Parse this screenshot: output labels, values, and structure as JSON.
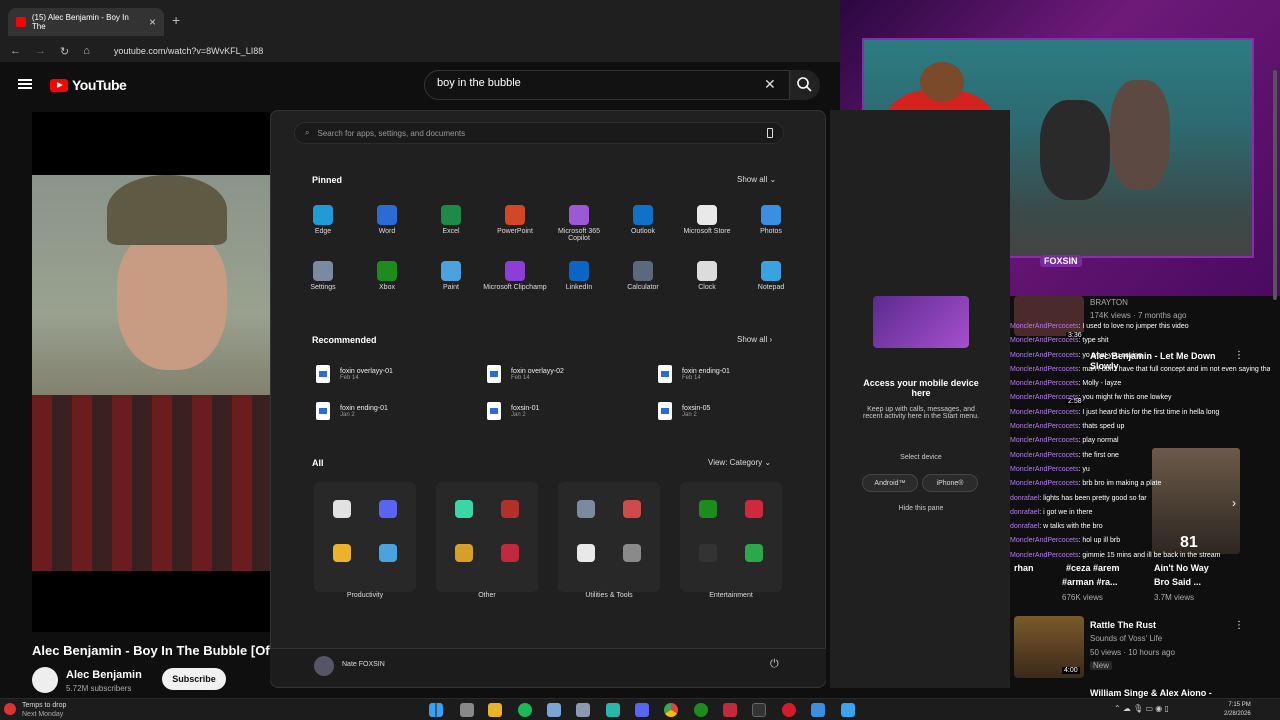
{
  "browser": {
    "tab_title": "(15) Alec Benjamin - Boy In The",
    "url": "youtube.com/watch?v=8WvKFL_LI88"
  },
  "youtube": {
    "logo_text": "YouTube",
    "search_query": "boy in the bubble"
  },
  "video": {
    "title": "Alec Benjamin - Boy In The Bubble [Offi",
    "channel": "Alec Benjamin",
    "subscribers": "5.72M subscribers",
    "subscribe_label": "Subscribe"
  },
  "start_menu": {
    "search_placeholder": "Search for apps, settings, and documents",
    "pinned_label": "Pinned",
    "show_all_label": "Show all",
    "pinned": [
      {
        "label": "Edge",
        "color": "#1f9bd7"
      },
      {
        "label": "Word",
        "color": "#2b6cd4"
      },
      {
        "label": "Excel",
        "color": "#1e8a4a"
      },
      {
        "label": "PowerPoint",
        "color": "#d24726"
      },
      {
        "label": "Microsoft 365 Copilot",
        "color": "#9b59d6"
      },
      {
        "label": "Outlook",
        "color": "#1072c7"
      },
      {
        "label": "Microsoft Store",
        "color": "#e9e9e9"
      },
      {
        "label": "Photos",
        "color": "#3a8fe0"
      },
      {
        "label": "Settings",
        "color": "#7a8aa0"
      },
      {
        "label": "Xbox",
        "color": "#1c8c1c"
      },
      {
        "label": "Paint",
        "color": "#4aa3df"
      },
      {
        "label": "Microsoft Clipchamp",
        "color": "#8c3fd6"
      },
      {
        "label": "LinkedIn",
        "color": "#0a66c2"
      },
      {
        "label": "Calculator",
        "color": "#5a6a7a"
      },
      {
        "label": "Clock",
        "color": "#dcdcdc"
      },
      {
        "label": "Notepad",
        "color": "#38a3e0"
      }
    ],
    "recommended_label": "Recommended",
    "recommended": [
      {
        "name": "foxin overlayy-01",
        "date": "Feb 14"
      },
      {
        "name": "foxin overlayy-02",
        "date": "Feb 14"
      },
      {
        "name": "foxin ending-01",
        "date": "Feb 14"
      },
      {
        "name": "foxin ending-01",
        "date": "Jan 2"
      },
      {
        "name": "foxsin-01",
        "date": "Jan 2"
      },
      {
        "name": "foxsin-05",
        "date": "Jan 2"
      }
    ],
    "all_label": "All",
    "view_label": "View: Category",
    "folders": [
      "Productivity",
      "Other",
      "Utilities & Tools",
      "Entertainment"
    ],
    "user_name": "Nate FOXSIN"
  },
  "phone_pane": {
    "title": "Access your mobile device here",
    "desc": "Keep up with calls, messages, and recent activity here in the Start menu.",
    "select_device": "Select device",
    "android": "Android™",
    "iphone": "iPhone®",
    "hide": "Hide this pane"
  },
  "overlay": {
    "badge": "FOXSIN"
  },
  "sidebar": {
    "v1": {
      "channel": "BRAYTON",
      "meta": "174K views · 7 months ago"
    },
    "v2": {
      "title": "Alec Benjamin - Let Me Down Slowly",
      "time1": "3:36"
    },
    "v3_time": "2:58",
    "v4": {
      "title_a": "rhan",
      "title_b": "#ceza #arem",
      "title_c": "#arman #ra...",
      "views_a": "676K views"
    },
    "v5": {
      "title": "Ain't No Way",
      "sub": "Bro Said ...",
      "views": "3.7M views"
    },
    "v6": {
      "title": "Rattle The Rust",
      "channel": "Sounds of Voss' Life",
      "meta": "50 views · 10 hours ago",
      "badge": "New",
      "time": "4:00"
    },
    "v7": {
      "title": "William Singe & Alex Aiono -"
    },
    "face_caption": "81"
  },
  "chat": [
    {
      "user": "MonclerAndPercocets",
      "msg": "I used to love no jumper this video"
    },
    {
      "user": "MonclerAndPercocets",
      "msg": "type shit"
    },
    {
      "user": "MonclerAndPercocets",
      "msg": "yo what you saying"
    },
    {
      "user": "MonclerAndPercocets",
      "msg": "man I don't have that full concept and im not even saying that in a downgrading way to them , just some people relate to things differently"
    },
    {
      "user": "MonclerAndPercocets",
      "msg": "Molly - layze"
    },
    {
      "user": "MonclerAndPercocets",
      "msg": "you might fw this one lowkey"
    },
    {
      "user": "MonclerAndPercocets",
      "msg": "I just heard this for the first time in hella long"
    },
    {
      "user": "MonclerAndPercocets",
      "msg": "thats sped up"
    },
    {
      "user": "MonclerAndPercocets",
      "msg": "play normal"
    },
    {
      "user": "MonclerAndPercocets",
      "msg": "the first one"
    },
    {
      "user": "MonclerAndPercocets",
      "msg": "yu"
    },
    {
      "user": "MonclerAndPercocets",
      "msg": "brb bro im making a plate"
    },
    {
      "user": "donrafael",
      "msg": "lights has been pretty good so far"
    },
    {
      "user": "donrafael",
      "msg": "i got we in there"
    },
    {
      "user": "donrafael",
      "msg": "w talks with the bro"
    },
    {
      "user": "MonclerAndPercocets",
      "msg": "hol up ill brb"
    },
    {
      "user": "MonclerAndPercocets",
      "msg": "gimmie 15 mins and ill be back in the stream"
    }
  ],
  "taskbar": {
    "weather_line1": "Temps to drop",
    "weather_line2": "Next Monday",
    "time": "7:15 PM",
    "date": "2/28/2026"
  }
}
